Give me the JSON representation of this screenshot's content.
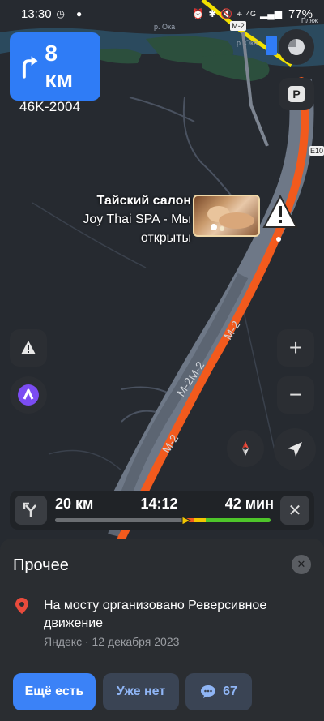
{
  "status_bar": {
    "time": "13:30",
    "network": "4G",
    "battery": "77%"
  },
  "map": {
    "labels": {
      "river_top": "р. Ока",
      "river_right": "р. Ока",
      "road_badge": "М-2",
      "e_badge": "E10",
      "corner_word": "Пляж",
      "road_labels": [
        "М-2",
        "М-2",
        "М-2",
        "М-2"
      ]
    },
    "colors": {
      "route": "#f25a1d",
      "road": "#6e7887",
      "water": "#2b4a5e",
      "greenery": "#2c4f3d",
      "background": "#262a30"
    }
  },
  "maneuver": {
    "distance": "8 км",
    "road": "46K-2004",
    "icon": "turn-right-icon"
  },
  "poi": {
    "title": "Тайский салон",
    "subtitle_line1": "Joy Thai SPA - Мы",
    "subtitle_line2": "открыты"
  },
  "controls": {
    "parking_label": "P",
    "zoom_in": "+",
    "zoom_out": "−"
  },
  "eta": {
    "remaining_distance": "20 км",
    "arrival_time": "14:12",
    "remaining_time": "42 мин",
    "close_label": "✕"
  },
  "sheet": {
    "heading": "Прочее",
    "message": "На мосту организовано Реверсивное движение",
    "source": "Яндекс · 12 декабря 2023",
    "buttons": {
      "yes": "Ещё есть",
      "no": "Уже нет",
      "comments_count": "67"
    }
  }
}
